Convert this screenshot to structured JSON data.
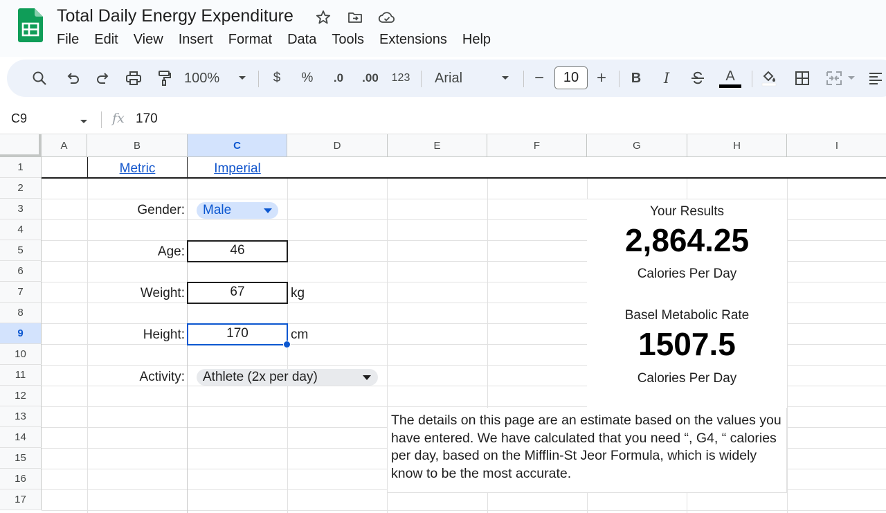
{
  "app": {
    "title": "Total Daily Energy Expenditure",
    "menu": [
      "File",
      "Edit",
      "View",
      "Insert",
      "Format",
      "Data",
      "Tools",
      "Extensions",
      "Help"
    ]
  },
  "toolbar": {
    "zoom": "100%",
    "currency": "$",
    "percent": "%",
    "decrease_decimal": ".0",
    "increase_decimal": ".00",
    "number_format": "123",
    "font": "Arial",
    "font_size": "10",
    "minus": "−",
    "plus": "+",
    "bold": "B",
    "italic": "I",
    "text_color": "A",
    "text_color_value": "#000000",
    "icons": [
      "search-icon",
      "undo-icon",
      "redo-icon",
      "print-icon",
      "paint-format-icon",
      "bold-icon",
      "italic-icon",
      "strikethrough-icon",
      "text-color-icon",
      "fill-color-icon",
      "borders-icon",
      "merge-cells-icon",
      "align-icon"
    ]
  },
  "formula_bar": {
    "name_box": "C9",
    "fx": "fx",
    "value": "170"
  },
  "grid": {
    "columns": [
      "A",
      "B",
      "C",
      "D",
      "E",
      "F",
      "G",
      "H",
      "I"
    ],
    "selected_column": "C",
    "rows": [
      "1",
      "2",
      "3",
      "4",
      "5",
      "6",
      "7",
      "8",
      "9",
      "10",
      "11",
      "12",
      "13",
      "14",
      "15",
      "16",
      "17"
    ],
    "selected_row": "9"
  },
  "sheet": {
    "metric_link": "Metric",
    "imperial_link": "Imperial",
    "gender_label": "Gender:",
    "gender_value": "Male",
    "age_label": "Age:",
    "age_value": "46",
    "weight_label": "Weight:",
    "weight_value": "67",
    "weight_unit": "kg",
    "height_label": "Height:",
    "height_value": "170",
    "height_unit": "cm",
    "activity_label": "Activity:",
    "activity_value": "Athlete (2x per day)"
  },
  "results": {
    "heading": "Your Results",
    "tdee_value": "2,864.25",
    "tdee_unit": "Calories Per Day",
    "bmr_heading": "Basel Metabolic Rate",
    "bmr_value": "1507.5",
    "bmr_unit": "Calories Per Day"
  },
  "note": {
    "text": "The details on this page are an estimate based on the values you have entered. We have calculated that you need “, G4, “ calories per day, based on the Mifflin-St Jeor Formula, which is widely know to be the most accurate."
  },
  "colors": {
    "accent": "#0b57d0",
    "selection_header": "#d3e3fd",
    "chip_blue": "#d3e3fd",
    "chip_grey": "#e8eaed",
    "link": "#1155cc",
    "sheets_green": "#0f9d58"
  }
}
